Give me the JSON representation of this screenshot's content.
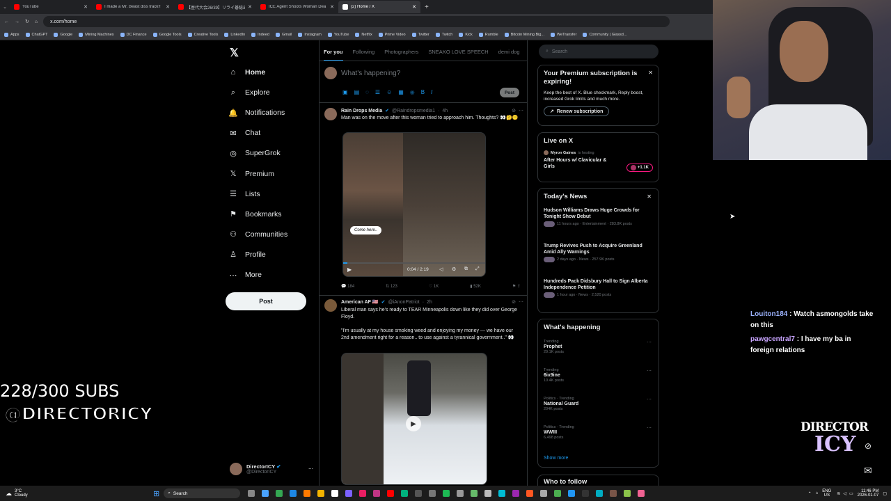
{
  "browser": {
    "tabs": [
      {
        "label": "YouTube",
        "color": "#ff0000",
        "active": false
      },
      {
        "label": "I made a Mr. Beast diss track!!",
        "color": "#ff0000",
        "active": false
      },
      {
        "label": "【歴代大会26/39】リライ碁総出",
        "color": "#ff0000",
        "active": false
      },
      {
        "label": "ICE Agent Shoots Woman Dea",
        "color": "#ff0000",
        "active": false
      },
      {
        "label": "(2) Home / X",
        "color": "#ffffff",
        "active": true
      }
    ],
    "url": "x.com/home",
    "bookmarks": [
      "Apps",
      "ChatGPT",
      "Google",
      "Mining Machines",
      "DC Finance",
      "Google Tools",
      "Creative Tools",
      "LinkedIn",
      "Indeed",
      "Gmail",
      "Instagram",
      "YouTube",
      "Netflix",
      "Prime Video",
      "Twitter",
      "Twitch",
      "Kick",
      "Rumble",
      "Bitcoin Mining Big...",
      "WeTransfer",
      "Community | Glassd..."
    ]
  },
  "sidebar": {
    "items": [
      {
        "label": "Home",
        "icon": "⌂"
      },
      {
        "label": "Explore",
        "icon": "⌕"
      },
      {
        "label": "Notifications",
        "icon": "🔔"
      },
      {
        "label": "Chat",
        "icon": "✉"
      },
      {
        "label": "SuperGrok",
        "icon": "◎"
      },
      {
        "label": "Premium",
        "icon": "𝕏"
      },
      {
        "label": "Lists",
        "icon": "☰"
      },
      {
        "label": "Bookmarks",
        "icon": "⚑"
      },
      {
        "label": "Communities",
        "icon": "⚇"
      },
      {
        "label": "Profile",
        "icon": "♙"
      },
      {
        "label": "More",
        "icon": "⋯"
      }
    ],
    "post_label": "Post",
    "profile_name": "DirectorICY",
    "profile_handle": "@DirectorICY"
  },
  "feed": {
    "tabs": [
      "For you",
      "Following",
      "Photographers",
      "SNEAKO LOVE SPEECH",
      "demi dog"
    ],
    "composer_placeholder": "What's happening?",
    "composer_post": "Post",
    "tweets": [
      {
        "name": "Rain Drops Media",
        "handle": "@Raindropsmedia1",
        "time": "4h",
        "text": "Man was on the move after this woman tried to approach him. Thoughts? 👀🤔😶",
        "caption": "Come here..",
        "video_time": "0:04 / 2:19",
        "replies": "184",
        "reposts": "123",
        "likes": "1K",
        "views": "52K"
      },
      {
        "name": "American AF 🇺🇸",
        "handle": "@iAnonPatriot",
        "time": "2h",
        "text": "Liberal man says he's ready to TEAR Minneapolis down like they did over George Floyd.",
        "text2": "\"I'm usually at my house smoking weed and enjoying my money — we have our 2nd amendment right for a reason.. to use against a tyrannical government..\" 👀"
      }
    ]
  },
  "right": {
    "search_placeholder": "Search",
    "premium": {
      "title": "Your Premium subscription is expiring!",
      "body": "Keep the best of X. Blue checkmark, Reply boost, increased Grok limits and much more.",
      "button": "Renew subscription"
    },
    "live": {
      "title": "Live on X",
      "host": "Myron Gaines",
      "host_suffix": "is hosting",
      "show": "After Hours w/ Clavicular & Girls",
      "count": "+1.1K"
    },
    "news": {
      "title": "Today's News",
      "items": [
        {
          "headline": "Hudson Williams Draws Huge Crowds for Tonight Show Debut",
          "meta": "11 hours ago · Entertainment · 283.8K posts"
        },
        {
          "headline": "Trump Revives Push to Acquire Greenland Amid Ally Warnings",
          "meta": "2 days ago · News · 257.9K posts"
        },
        {
          "headline": "Hundreds Pack Didsbury Hall to Sign Alberta Independence Petition",
          "meta": "1 hour ago · News · 2,520 posts"
        }
      ]
    },
    "happening": {
      "title": "What's happening",
      "items": [
        {
          "context": "Trending",
          "topic": "Prophet",
          "posts": "29.1K posts"
        },
        {
          "context": "Trending",
          "topic": "6ix9ine",
          "posts": "10.4K posts"
        },
        {
          "context": "Politics · Trending",
          "topic": "National Guard",
          "posts": "204K posts"
        },
        {
          "context": "Politics · Trending",
          "topic": "WWIII",
          "posts": "6,498 posts"
        }
      ],
      "show_more": "Show more"
    },
    "who_to_follow": "Who to follow"
  },
  "overlay": {
    "subs": "228/300 SUBS",
    "handle": "@DIRECTORICY",
    "chat": [
      {
        "user": "Louiton184",
        "msg": "Watch asmongolds take on this"
      },
      {
        "user": "pawgcentral7",
        "msg": "I have my ba in foreign relations"
      }
    ],
    "logo_line1": "DIRECTOR",
    "logo_line2": "ICY"
  },
  "taskbar": {
    "weather_temp": "3°C",
    "weather_desc": "Cloudy",
    "search": "Search",
    "lang": "ENG",
    "region": "US",
    "time": "11:46 PM",
    "date": "2026-01-07"
  }
}
